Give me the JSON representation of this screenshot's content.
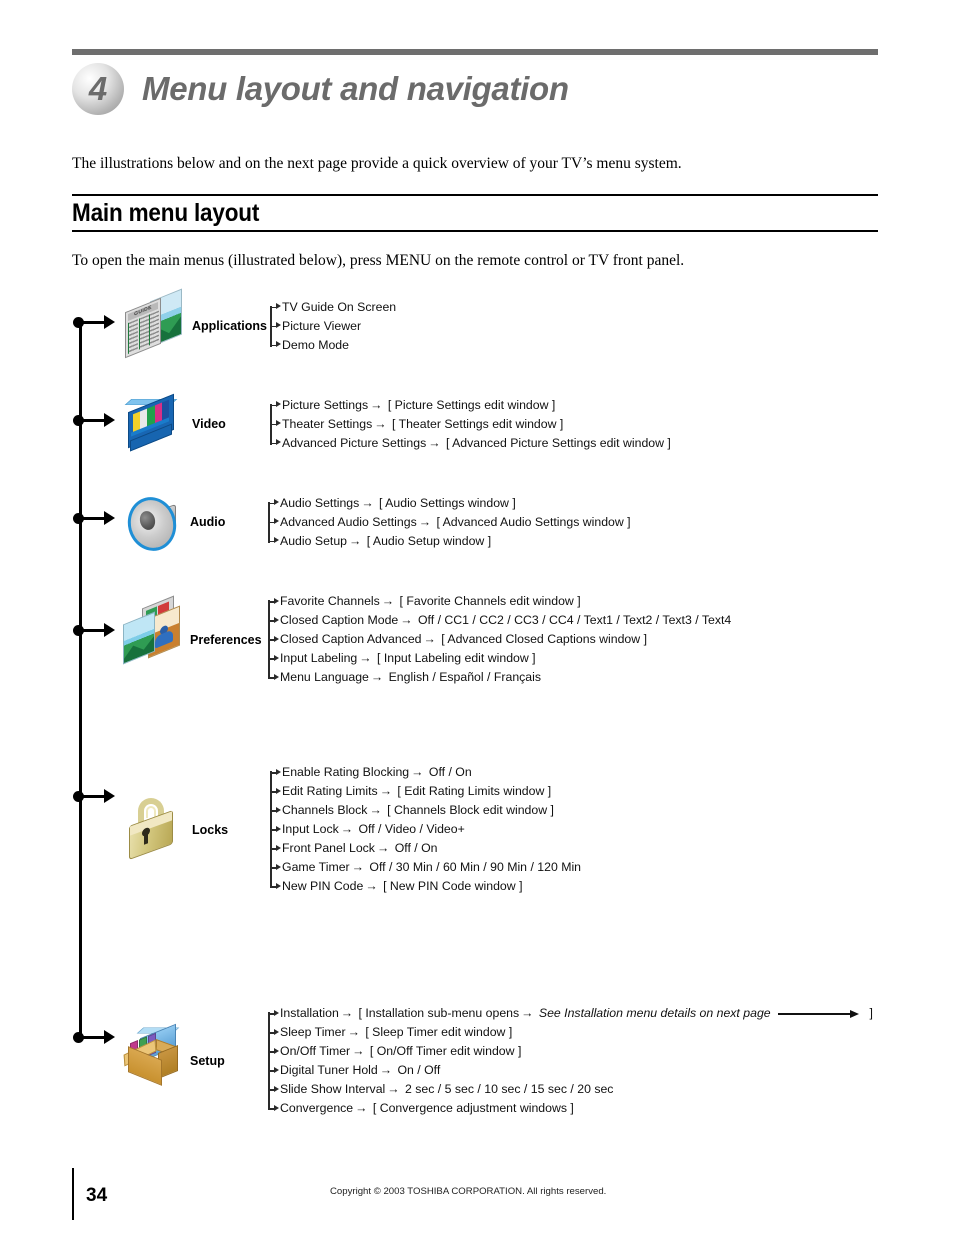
{
  "header": {
    "chapter_number": "4",
    "chapter_title": "Menu layout and navigation",
    "intro": "The illustrations below and on the next page provide a quick overview of your TV’s menu system."
  },
  "section": {
    "title": "Main menu layout",
    "lead": "To open the main menus (illustrated below), press MENU on the remote control or TV front panel."
  },
  "menu_groups": [
    {
      "label": "Applications",
      "icon": "applications-guide-photo-icon",
      "items": [
        {
          "name": "TV Guide On Screen",
          "arrow": "",
          "value": ""
        },
        {
          "name": "Picture Viewer",
          "arrow": "",
          "value": ""
        },
        {
          "name": "Demo Mode",
          "arrow": "",
          "value": ""
        }
      ]
    },
    {
      "label": "Video",
      "icon": "television-icon",
      "items": [
        {
          "name": "Picture Settings",
          "arrow": "→",
          "value": "[ Picture Settings edit window ]"
        },
        {
          "name": "Theater Settings",
          "arrow": "→",
          "value": "[ Theater Settings edit window ]"
        },
        {
          "name": "Advanced Picture Settings",
          "arrow": "→",
          "value": "[ Advanced Picture Settings edit window ]"
        }
      ]
    },
    {
      "label": "Audio",
      "icon": "speaker-icon",
      "items": [
        {
          "name": "Audio Settings",
          "arrow": "→",
          "value": "[ Audio Settings window ]"
        },
        {
          "name": "Advanced Audio Settings",
          "arrow": "→",
          "value": "[ Advanced Audio Settings window ]"
        },
        {
          "name": "Audio Setup",
          "arrow": "→",
          "value": "[ Audio Setup window ]"
        }
      ]
    },
    {
      "label": "Preferences",
      "icon": "photos-stack-icon",
      "items": [
        {
          "name": "Favorite Channels",
          "arrow": "→",
          "value": "[ Favorite Channels edit window ]"
        },
        {
          "name": "Closed Caption Mode",
          "arrow": "→",
          "value": "Off / CC1 / CC2 / CC3 / CC4 / Text1 / Text2 / Text3 / Text4"
        },
        {
          "name": "Closed Caption Advanced",
          "arrow": "→",
          "value": "[ Advanced Closed Captions window ]"
        },
        {
          "name": "Input Labeling",
          "arrow": "→",
          "value": "[ Input Labeling edit window ]"
        },
        {
          "name": "Menu Language",
          "arrow": "→",
          "value": "English / Español / Français"
        }
      ]
    },
    {
      "label": "Locks",
      "icon": "padlock-icon",
      "items": [
        {
          "name": "Enable Rating Blocking",
          "arrow": "→",
          "value": "Off / On"
        },
        {
          "name": "Edit Rating Limits",
          "arrow": "→",
          "value": "[ Edit Rating Limits window ]"
        },
        {
          "name": "Channels Block",
          "arrow": "→",
          "value": "[ Channels Block edit window ]"
        },
        {
          "name": "Input Lock",
          "arrow": "→",
          "value": "Off / Video / Video+"
        },
        {
          "name": "Front Panel Lock",
          "arrow": "→",
          "value": "Off / On"
        },
        {
          "name": "Game Timer",
          "arrow": "→",
          "value": "Off / 30 Min / 60 Min / 90 Min / 120 Min"
        },
        {
          "name": "New PIN Code",
          "arrow": "→",
          "value": "[ New PIN Code window ]"
        }
      ]
    },
    {
      "label": "Setup",
      "icon": "setup-box-icon",
      "items": [
        {
          "name": "Installation",
          "arrow": "→",
          "value": "[ Installation sub-menu opens",
          "value_arrow": "→",
          "italic_note": "See Installation menu details on next page",
          "trailing": "]"
        },
        {
          "name": "Sleep Timer",
          "arrow": "→",
          "value": "[ Sleep Timer edit window ]"
        },
        {
          "name": "On/Off Timer",
          "arrow": "→",
          "value": "[ On/Off Timer edit window ]"
        },
        {
          "name": "Digital Tuner Hold",
          "arrow": "→",
          "value": "On / Off"
        },
        {
          "name": "Slide Show Interval",
          "arrow": "→",
          "value": "2 sec / 5 sec / 10 sec / 15 sec / 20 sec"
        },
        {
          "name": "Convergence",
          "arrow": "→",
          "value": "[ Convergence adjustment windows ]"
        }
      ]
    }
  ],
  "footer": {
    "page_number": "34",
    "copyright": "Copyright © 2003 TOSHIBA CORPORATION. All rights reserved."
  }
}
